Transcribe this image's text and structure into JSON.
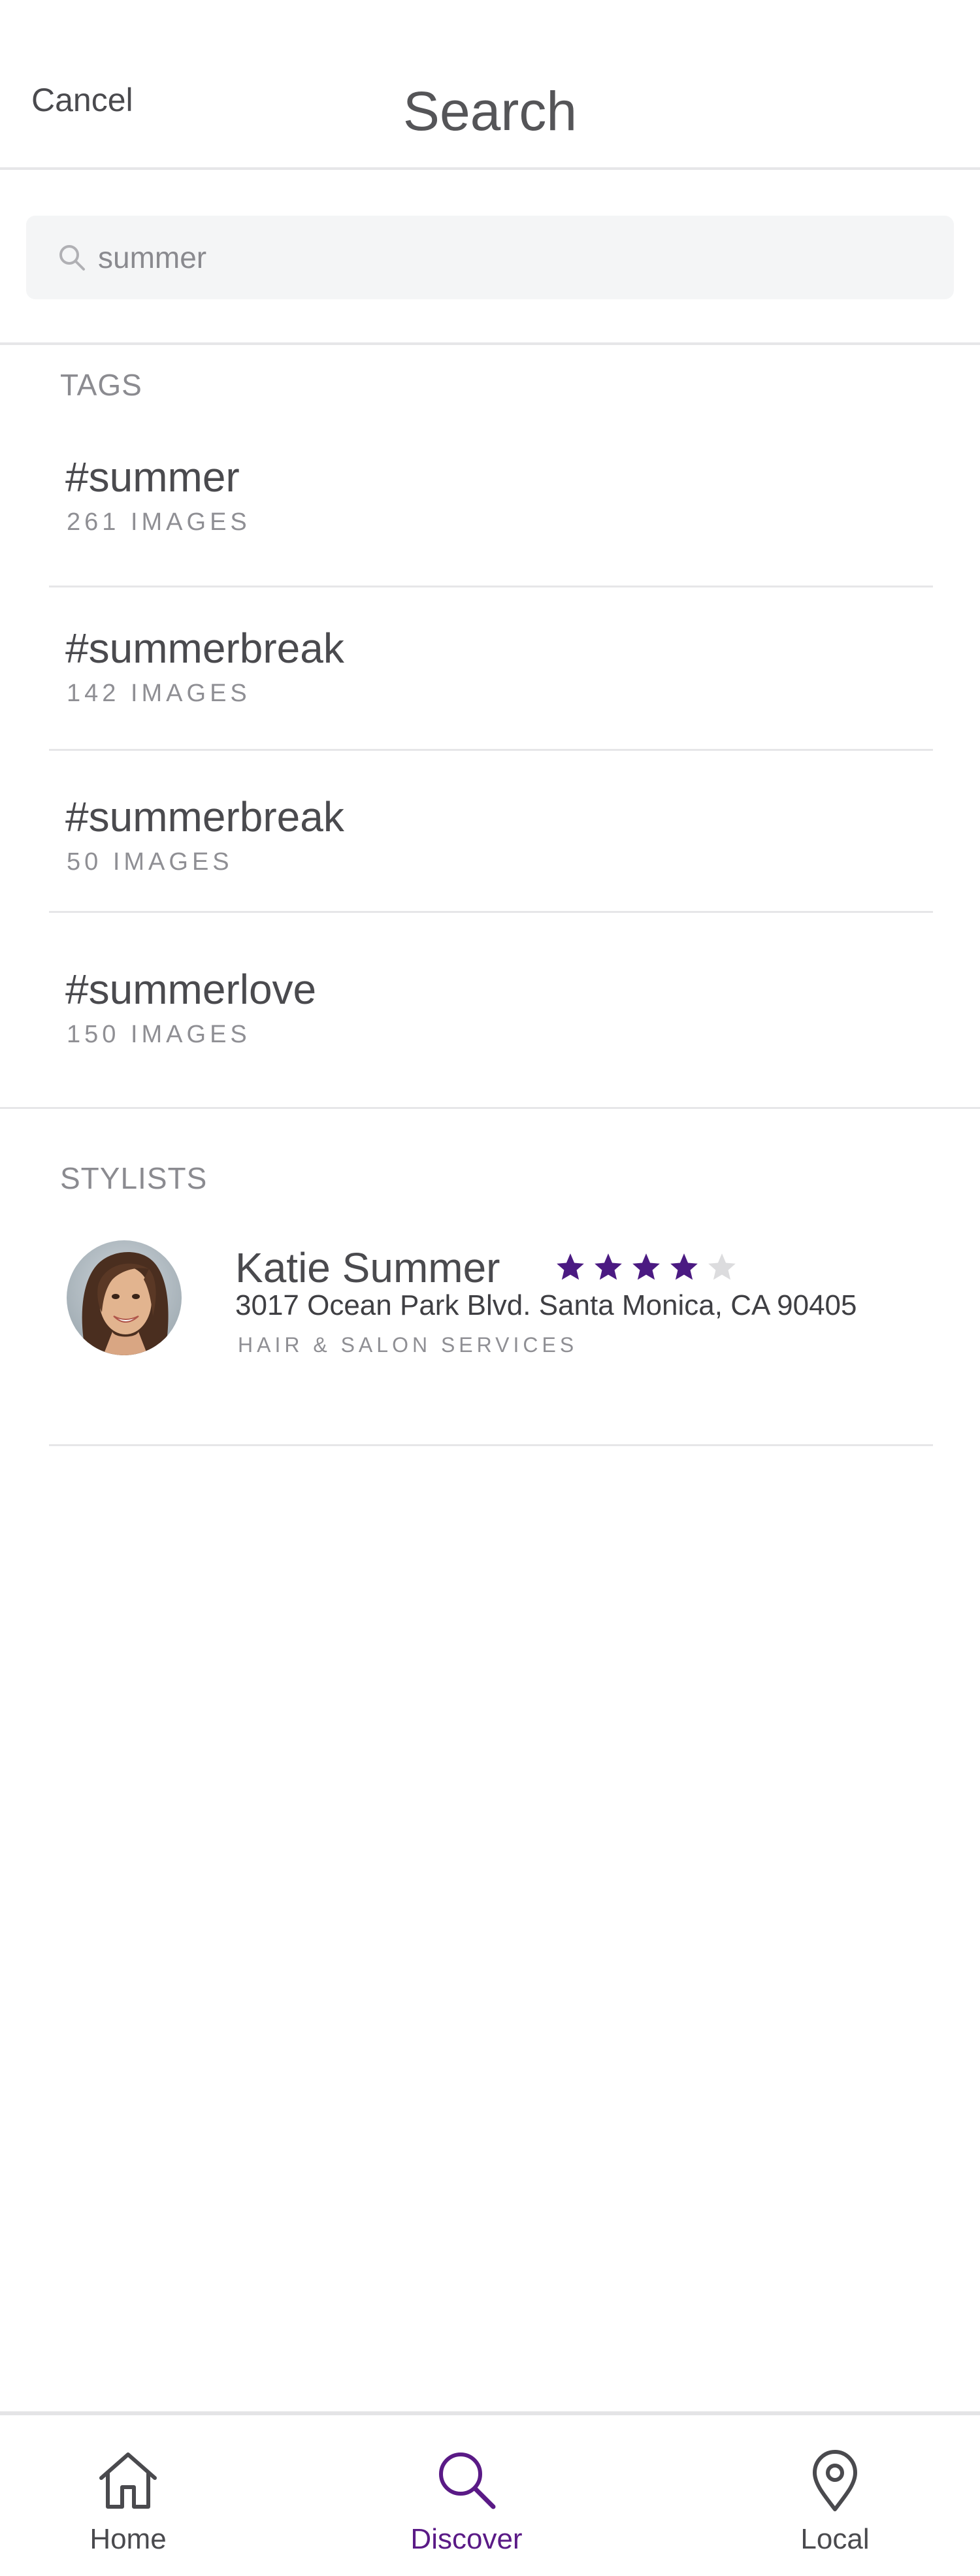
{
  "header": {
    "cancel_label": "Cancel",
    "title": "Search"
  },
  "search": {
    "value": "summer",
    "icon": "search-icon"
  },
  "tags_section": {
    "label": "TAGS",
    "items": [
      {
        "name": "#summer",
        "count": "261 IMAGES"
      },
      {
        "name": "#summerbreak",
        "count": "142 IMAGES"
      },
      {
        "name": "#summerbreak",
        "count": "50 IMAGES"
      },
      {
        "name": "#summerlove",
        "count": "150 IMAGES"
      }
    ]
  },
  "stylists_section": {
    "label": "STYLISTS",
    "items": [
      {
        "name": "Katie Summer",
        "rating": 4,
        "rating_max": 5,
        "address": "3017 Ocean Park Blvd. Santa Monica, CA 90405",
        "category": "HAIR & SALON SERVICES"
      }
    ]
  },
  "bottom_nav": {
    "items": [
      {
        "label": "Home",
        "icon": "home-icon",
        "active": false
      },
      {
        "label": "Discover",
        "icon": "search-icon",
        "active": true
      },
      {
        "label": "Local",
        "icon": "location-pin-icon",
        "active": false
      }
    ]
  },
  "colors": {
    "accent": "#5a1a86",
    "star_filled": "#4b1a82",
    "star_empty": "#dcdcde",
    "divider": "#e6e6e8",
    "search_bg": "#f4f5f6"
  }
}
